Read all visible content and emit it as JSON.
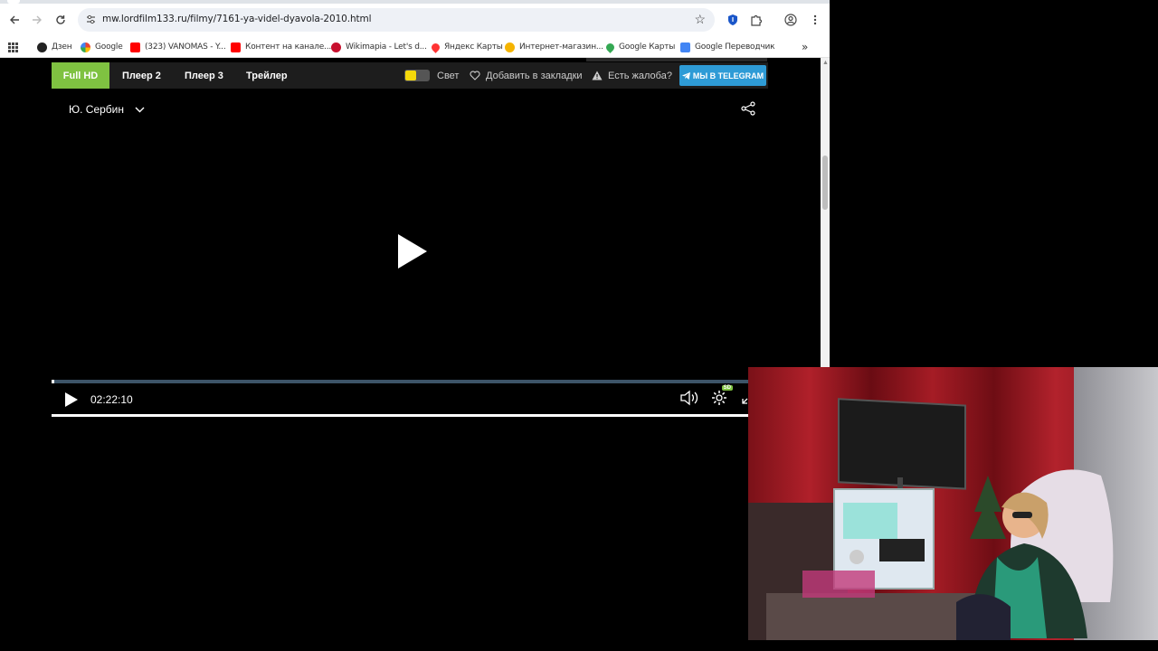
{
  "browser": {
    "url": "mw.lordfilm133.ru/filmy/7161-ya-videl-dyavola-2010.html"
  },
  "bookmarks": [
    {
      "label": "Дзен",
      "color": "#222222"
    },
    {
      "label": "Google",
      "color": "#4285f4"
    },
    {
      "label": "(323) VANOMAS - Y...",
      "color": "#ff0000"
    },
    {
      "label": "Контент на канале...",
      "color": "#ff0000"
    },
    {
      "label": "Wikimapia - Let's d...",
      "color": "#c8102e"
    },
    {
      "label": "Яндекс Карты",
      "color": "#ff3333"
    },
    {
      "label": "Интернет-магазин...",
      "color": "#f5b400"
    },
    {
      "label": "Google Карты",
      "color": "#34a853"
    },
    {
      "label": "Google Переводчик",
      "color": "#4285f4"
    }
  ],
  "player": {
    "tabs": [
      "Full HD",
      "Плеер 2",
      "Плеер 3",
      "Трейлер"
    ],
    "light_label": "Свет",
    "bookmark_label": "Добавить в закладки",
    "complaint_label": "Есть жалоба?",
    "telegram_label": "МЫ В TELEGRAM",
    "dub_label": "Ю. Сербин",
    "time": "02:22:10",
    "quality_badge": "SD",
    "progress_fraction": 0.004
  },
  "colors": {
    "accent_green": "#7fc241",
    "telegram_blue": "#2e9bd6"
  }
}
